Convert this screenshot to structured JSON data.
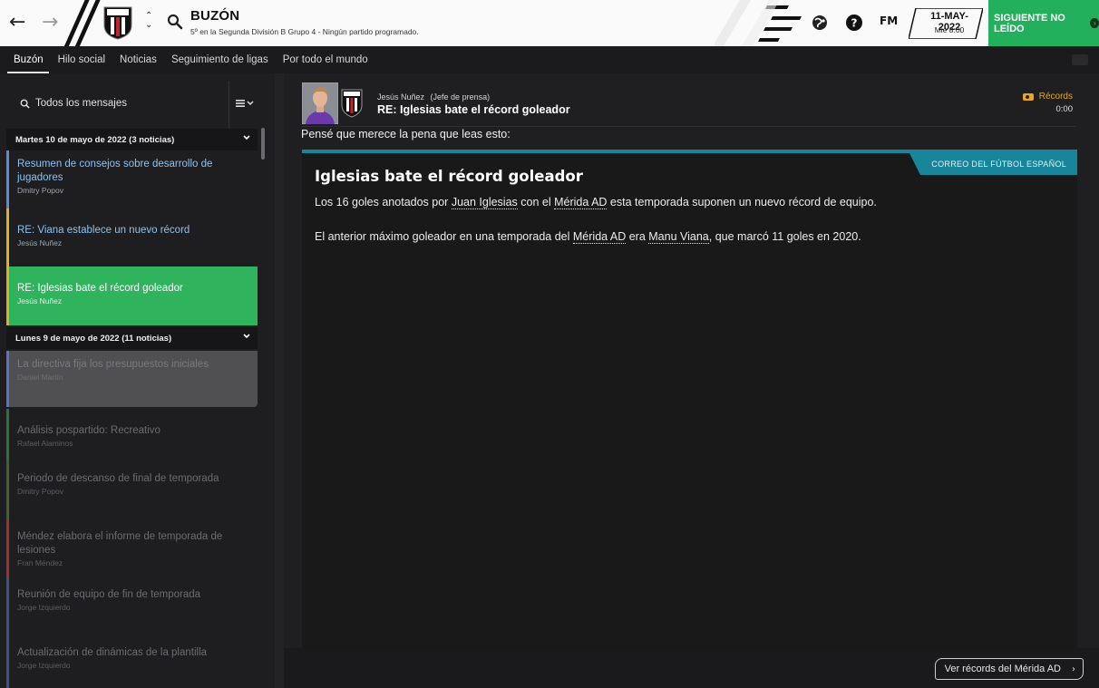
{
  "topbar": {
    "title": "BUZÓN",
    "subtitle": "5º en la Segunda División B Grupo 4 - Ningún partido programado.",
    "fm_logo": "FM",
    "date": "11-MAY-2022",
    "day_time": "Mié 8:00",
    "next_button": "SIGUIENTE NO LEÍDO",
    "accent_color": "#23b05c"
  },
  "tabs": [
    "Buzón",
    "Hilo social",
    "Noticias",
    "Seguimiento de ligas",
    "Por todo el mundo"
  ],
  "sidebar": {
    "search_label": "Todos los mensajes",
    "groups": [
      {
        "header": "Martes 10 de mayo de 2022 (3 noticias)",
        "messages": [
          {
            "subject": "Resumen de consejos sobre desarrollo de jugadores",
            "sender": "Dmitry Popov",
            "color": "#5a8bd6"
          },
          {
            "subject": "RE: Viana establece un nuevo récord",
            "sender": "Jesús Nuñez",
            "color": "#e2b11f"
          },
          {
            "subject": "RE: Iglesias bate el récord goleador",
            "sender": "Jesús Nuñez",
            "color": "#e2b11f"
          }
        ]
      },
      {
        "header": "Lunes 9 de mayo de 2022 (11 noticias)",
        "messages": [
          {
            "subject": "La directiva fija los presupuestos iniciales",
            "sender": "Daniel Martín",
            "color": "#5a73c8"
          },
          {
            "subject": "Análisis pospartido: Recreativo",
            "sender": "Rafael Alaminos",
            "color": "#3fa55a"
          },
          {
            "subject": "Periodo de descanso de final de temporada",
            "sender": "Dmitry Popov",
            "color": "#5c8f3c"
          },
          {
            "subject": "Méndez elabora el informe de temporada de lesiones",
            "sender": "Fran Méndez",
            "color": "#c83a3a"
          },
          {
            "subject": "Reunión de equipo de fin de temporada",
            "sender": "Jorge Izquierdo",
            "color": "#5a73c8"
          },
          {
            "subject": "Actualización de dinámicas de la plantilla",
            "sender": "Jorge Izquierdo",
            "color": "#5a73c8"
          }
        ]
      }
    ]
  },
  "message": {
    "sender_name": "Jesús Nuñez",
    "sender_role": "(Jefe de prensa)",
    "title": "RE: Iglesias bate el récord goleador",
    "category": "Récords",
    "time": "0:00",
    "intro": "Pensé que merece la pena que leas esto:",
    "source": "CORREO DEL FÚTBOL ESPAÑOL",
    "article_title": "Iglesias bate el récord goleador",
    "p1": {
      "a": "Los 16 goles anotados por ",
      "link1": "Juan Iglesias",
      "b": " con el ",
      "link2": "Mérida AD",
      "c": " esta temporada suponen un nuevo récord de equipo."
    },
    "p2": {
      "a": "El anterior máximo goleador en una temporada del ",
      "link1": "Mérida AD",
      "b": " era ",
      "link2": "Manu Viana",
      "c": ", que marcó 11 goles en 2020."
    },
    "records_button": "Ver récords del Mérida AD"
  }
}
